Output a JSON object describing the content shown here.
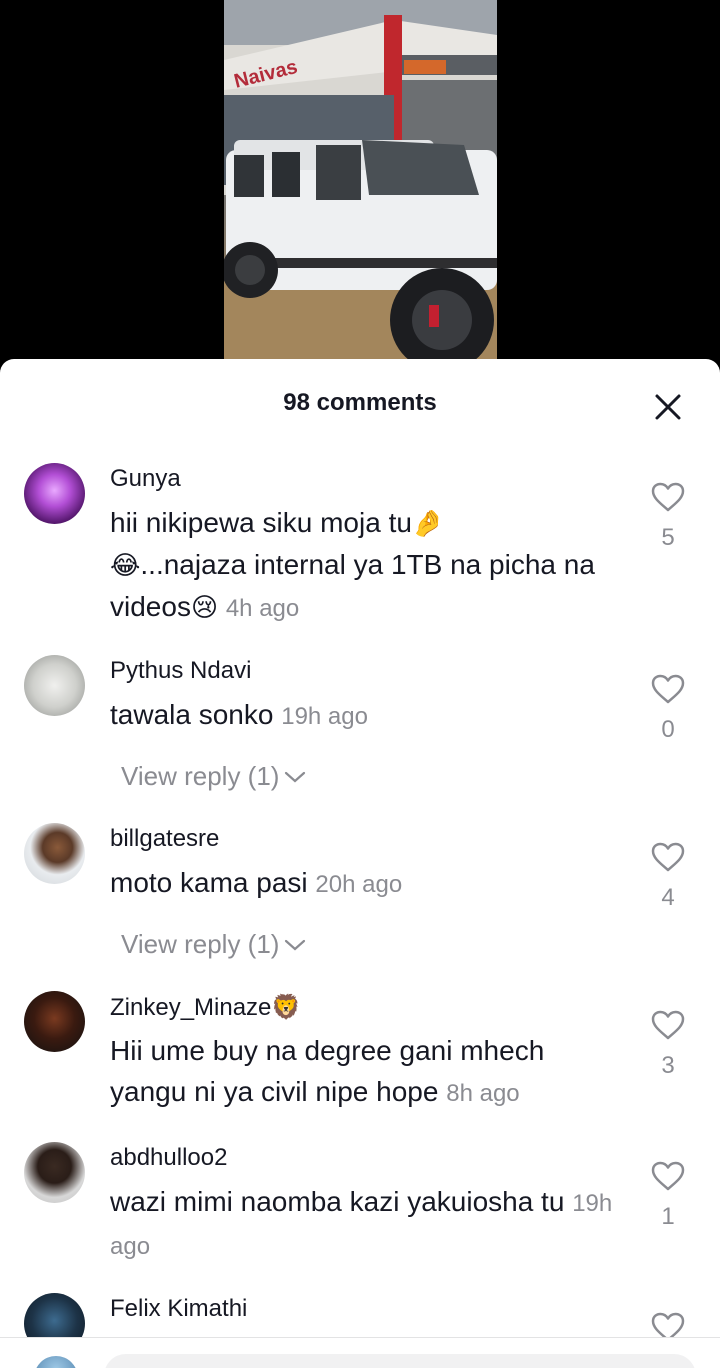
{
  "video": {
    "store_sign": "Naivas"
  },
  "sheet": {
    "title": "98 comments",
    "close_icon": "close-icon"
  },
  "comments": [
    {
      "username": "Gunya",
      "text_part1": "hii nikipewa siku moja tu",
      "emoji1": "🤌",
      "emoji2": "😂",
      "text_part2": "...najaza internal ya 1TB na picha na videos",
      "emoji3": "😢",
      "time": "4h ago",
      "likes": "5"
    },
    {
      "username": "Pythus Ndavi",
      "text": "tawala sonko",
      "time": "19h ago",
      "likes": "0",
      "view_reply": "View reply (1)"
    },
    {
      "username": "billgatesre",
      "text": "moto kama pasi",
      "time": "20h ago",
      "likes": "4",
      "view_reply": "View reply (1)"
    },
    {
      "username": "Zinkey_Minaze",
      "username_emoji": "🦁",
      "text": "Hii ume buy na degree gani mhech yangu ni ya civil nipe hope",
      "time": "8h ago",
      "likes": "3"
    },
    {
      "username": "abdhulloo2",
      "text": "wazi mimi naomba kazi yakuiosha tu",
      "time": "19h ago",
      "likes": "1"
    },
    {
      "username": "Felix Kimathi"
    }
  ],
  "colors": {
    "text": "#161823",
    "muted": "#8a8b91"
  }
}
